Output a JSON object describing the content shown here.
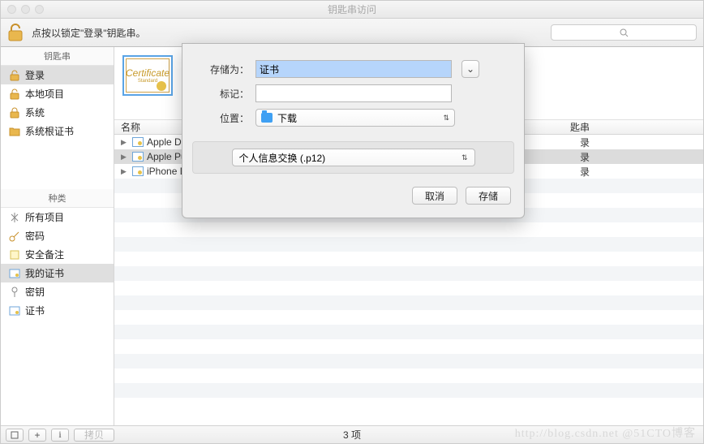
{
  "window": {
    "title": "钥匙串访问"
  },
  "toolbar": {
    "lock_hint": "点按以锁定\"登录\"钥匙串。",
    "search_placeholder": "Q"
  },
  "sidebar": {
    "section_keychains": "钥匙串",
    "section_category": "种类",
    "keychains": [
      {
        "label": "登录",
        "icon": "unlock"
      },
      {
        "label": "本地项目",
        "icon": "unlock"
      },
      {
        "label": "系统",
        "icon": "lock"
      },
      {
        "label": "系统根证书",
        "icon": "folder"
      }
    ],
    "categories": [
      {
        "label": "所有项目",
        "icon": "all"
      },
      {
        "label": "密码",
        "icon": "key"
      },
      {
        "label": "安全备注",
        "icon": "note"
      },
      {
        "label": "我的证书",
        "icon": "cert"
      },
      {
        "label": "密钥",
        "icon": "keypair"
      },
      {
        "label": "证书",
        "icon": "cert"
      }
    ]
  },
  "cert_thumb": {
    "line1": "Certificate",
    "line2": "Standard"
  },
  "list": {
    "header_name": "名称",
    "header_keychain": "匙串",
    "rows": [
      {
        "name": "Apple De",
        "value": "录"
      },
      {
        "name": "Apple Pu",
        "value": "录"
      },
      {
        "name": "iPhone D",
        "value": "录"
      }
    ]
  },
  "dialog": {
    "save_as_label": "存储为：",
    "save_as_value": "证书",
    "tags_label": "标记：",
    "tags_value": "",
    "where_label": "位置：",
    "where_value": "下载",
    "format_value": "个人信息交换 (.p12)",
    "cancel": "取消",
    "save": "存储"
  },
  "status": {
    "count": "3 项",
    "copy_label": "拷贝"
  },
  "watermark": "http://blog.csdn.net @51CTO博客"
}
